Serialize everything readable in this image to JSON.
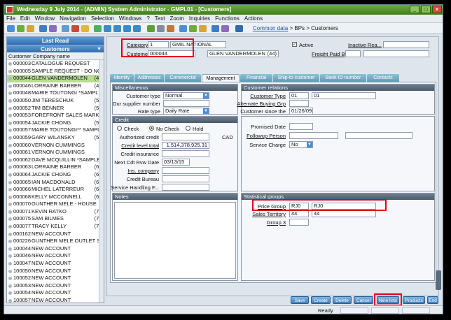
{
  "window": {
    "title": "Wednesday 9 July 2014 - (ADMIN) System Administrator - GMPL01 - [Customers]"
  },
  "menu": [
    "File",
    "Edit",
    "Window",
    "Navigation",
    "Selection",
    "Windows",
    "?",
    "Text",
    "Zoom",
    "Inquiries",
    "Functions",
    "Actions"
  ],
  "breadcrumb": {
    "link": "Common data",
    "rest": " > BPs > Customers"
  },
  "left_panel": {
    "header1": "Last Read",
    "header2": "Customers",
    "col_code": "Customer",
    "col_name": "Company name",
    "rows": [
      {
        "code": "000003",
        "name": "CATALOGUE REQUEST",
        "count": ""
      },
      {
        "code": "000005",
        "name": "SAMPLE REQUEST - DO NO",
        "count": ""
      },
      {
        "code": "000044",
        "name": "GLEN VANDERMOLEN",
        "count": "(44)",
        "selected": true
      },
      {
        "code": "000046",
        "name": "LORRAINE BARBER",
        "count": "(46)"
      },
      {
        "code": "000048",
        "name": "MARIE TOUTONGI *SAMPLE",
        "count": ""
      },
      {
        "code": "000050",
        "name": "JIM TERESCHUK",
        "count": "(50)"
      },
      {
        "code": "000052",
        "name": "TIM BENNER",
        "count": "(52)"
      },
      {
        "code": "000053",
        "name": "FOREFRONT SALES MARK",
        "count": ""
      },
      {
        "code": "000054",
        "name": "JACKIE CHONG",
        "count": "(54)"
      },
      {
        "code": "000057",
        "name": "MARIE TOUTONGI** SAMPL",
        "count": ""
      },
      {
        "code": "000059",
        "name": "GARY WILANSKY",
        "count": "(59)"
      },
      {
        "code": "000060",
        "name": "VERNON CUMMINGS",
        "count": ""
      },
      {
        "code": "000061",
        "name": "VERNON CUMMINGS",
        "count": ""
      },
      {
        "code": "000062",
        "name": "DAVE MCQUILLIN *SAMPLE",
        "count": ""
      },
      {
        "code": "000063",
        "name": "LORRAINE BARBER",
        "count": "(63)"
      },
      {
        "code": "000064",
        "name": "JACKIE CHONG",
        "count": "(64)"
      },
      {
        "code": "000065",
        "name": "IAN MACDONALD",
        "count": "(65)"
      },
      {
        "code": "000066",
        "name": "MICHEL LATERREUR",
        "count": "(66)"
      },
      {
        "code": "000068",
        "name": "KELLY MCCONNELL",
        "count": "(68)"
      },
      {
        "code": "000070",
        "name": "GUNTHER MELE - HOUSE",
        "count": ""
      },
      {
        "code": "000071",
        "name": "KEVIN RATKO",
        "count": "(71)"
      },
      {
        "code": "000075",
        "name": "SAM BILMES",
        "count": "(75)"
      },
      {
        "code": "000077",
        "name": "TRACY KELLY",
        "count": "(77)"
      },
      {
        "code": "000162",
        "name": "NEW ACCOUNT",
        "count": ""
      },
      {
        "code": "000226",
        "name": "GUNTHER MELE OUTLET S",
        "count": ""
      },
      {
        "code": "100044",
        "name": "NEW ACCOUNT",
        "count": ""
      },
      {
        "code": "100046",
        "name": "NEW ACCOUNT",
        "count": ""
      },
      {
        "code": "100047",
        "name": "NEW ACCOUNT",
        "count": ""
      },
      {
        "code": "100050",
        "name": "NEW ACCOUNT",
        "count": ""
      },
      {
        "code": "100052",
        "name": "NEW ACCOUNT",
        "count": ""
      },
      {
        "code": "100053",
        "name": "NEW ACCOUNT",
        "count": ""
      },
      {
        "code": "100054",
        "name": "NEW ACCOUNT",
        "count": ""
      },
      {
        "code": "100057",
        "name": "NEW ACCOUNT",
        "count": ""
      }
    ]
  },
  "header": {
    "category_label": "Category",
    "category_value": "1",
    "category_desc": "GMIL NATIONAL",
    "customer_label": "Customer",
    "customer_value": "000044",
    "customer_name": "GLEN VANDERMOLEN",
    "customer_count": "(44)",
    "active_label": "Active",
    "inactive_label": "Inactive Rea...",
    "freight_label": "Freight Paid By"
  },
  "tabs": [
    "Identity",
    "Addresses",
    "Commercial",
    "Management",
    "Financial",
    "Ship-to customer",
    "Bank ID number",
    "Contacts"
  ],
  "misc": {
    "title": "Miscellaneous",
    "customer_type_label": "Customer type",
    "customer_type_value": "Normal",
    "supplier_label": "Our supplier number",
    "rate_type_label": "Rate type",
    "rate_type_value": "Daily Rate"
  },
  "credit": {
    "title": "Credit",
    "opt_check": "Check",
    "opt_nocheck": "No Check",
    "opt_hold": "Hold",
    "authorized_label": "Authorized credit",
    "currency": "CAD",
    "level_label": "Credit level total",
    "level_value": "1,514,378,925.31",
    "insurance_label": "Credit insurance",
    "review_label": "Next Cdt Rvw Date",
    "review_value": "03/13/15",
    "inscompany_label": "Ins. company",
    "bureau_label": "Credit Bureau",
    "handling_label": "Service Handling F..."
  },
  "notes": {
    "title": "Notes"
  },
  "relations": {
    "title": "Customer relations",
    "custtype_label": "Customer Type",
    "custtype_value1": "01",
    "custtype_value2": "01",
    "altbuy_label": "Alternate Buying Grp",
    "since_label": "Customer since the",
    "since_value": "01/26/09"
  },
  "promo": {
    "promised_label": "Promised Date",
    "followup_label": "Followup Person",
    "service_label": "Service Charge",
    "service_value": "No"
  },
  "stats": {
    "title": "Statistical groups",
    "price_label": "Price Group",
    "price_value1": "RJ0",
    "price_value2": "RJ0",
    "sales_label": "Sales Territory",
    "sales_value1": "44",
    "sales_value2": "44",
    "group3_label": "Group 3"
  },
  "buttons": [
    "Save",
    "Create",
    "Delete",
    "Cancel",
    "Nine lists",
    "Products",
    "End"
  ],
  "status": {
    "text": "Ready"
  },
  "colors": {
    "highlight": "#e0001a",
    "selected_row": "#b9dc8f",
    "title_green": "#4f8e28"
  }
}
